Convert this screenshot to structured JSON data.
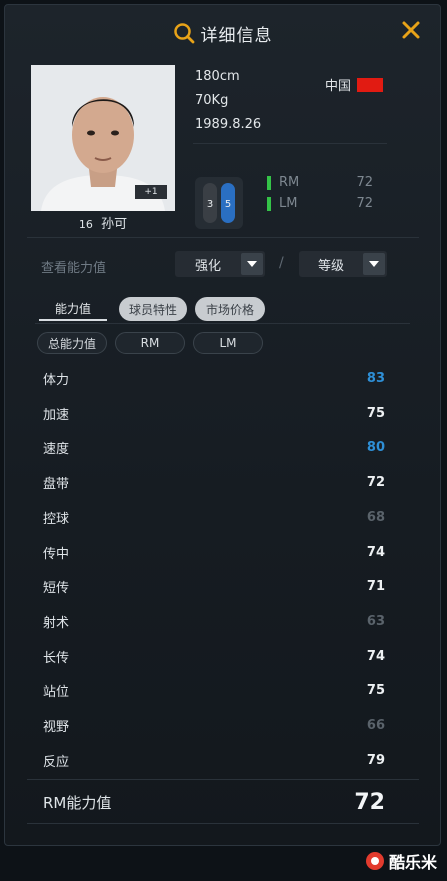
{
  "header": {
    "title": "详细信息"
  },
  "player": {
    "height": "180cm",
    "weight": "70Kg",
    "birth": "1989.8.26",
    "country": "中国",
    "jersey_number": "16",
    "name": "孙可",
    "photo_badge": "+1",
    "position_card_numbers": [
      "3",
      "5"
    ],
    "positions": [
      {
        "label": "RM",
        "value": "72"
      },
      {
        "label": "LM",
        "value": "72"
      }
    ]
  },
  "filters": {
    "label": "查看能力值",
    "enhance": "强化",
    "grade": "等级",
    "separator": "/"
  },
  "tabs": {
    "items": [
      "能力值",
      "球员特性",
      "市场价格"
    ],
    "sub_items": [
      "总能力值",
      "RM",
      "LM"
    ]
  },
  "stats": [
    {
      "name": "体力",
      "value": "83",
      "color": "#2e8fd6"
    },
    {
      "name": "加速",
      "value": "75",
      "color": "#eef1f3"
    },
    {
      "name": "速度",
      "value": "80",
      "color": "#2e8fd6"
    },
    {
      "name": "盘带",
      "value": "72",
      "color": "#eef1f3"
    },
    {
      "name": "控球",
      "value": "68",
      "color": "#5a636b"
    },
    {
      "name": "传中",
      "value": "74",
      "color": "#eef1f3"
    },
    {
      "name": "短传",
      "value": "71",
      "color": "#eef1f3"
    },
    {
      "name": "射术",
      "value": "63",
      "color": "#5a636b"
    },
    {
      "name": "长传",
      "value": "74",
      "color": "#eef1f3"
    },
    {
      "name": "站位",
      "value": "75",
      "color": "#eef1f3"
    },
    {
      "name": "视野",
      "value": "66",
      "color": "#5a636b"
    },
    {
      "name": "反应",
      "value": "79",
      "color": "#eef1f3"
    }
  ],
  "total": {
    "label": "RM能力值",
    "value": "72"
  },
  "watermark": {
    "text": "酷乐米"
  },
  "colors": {
    "accent": "#e8a318",
    "flag": "#e11b12",
    "position_bar": "#34c348"
  }
}
